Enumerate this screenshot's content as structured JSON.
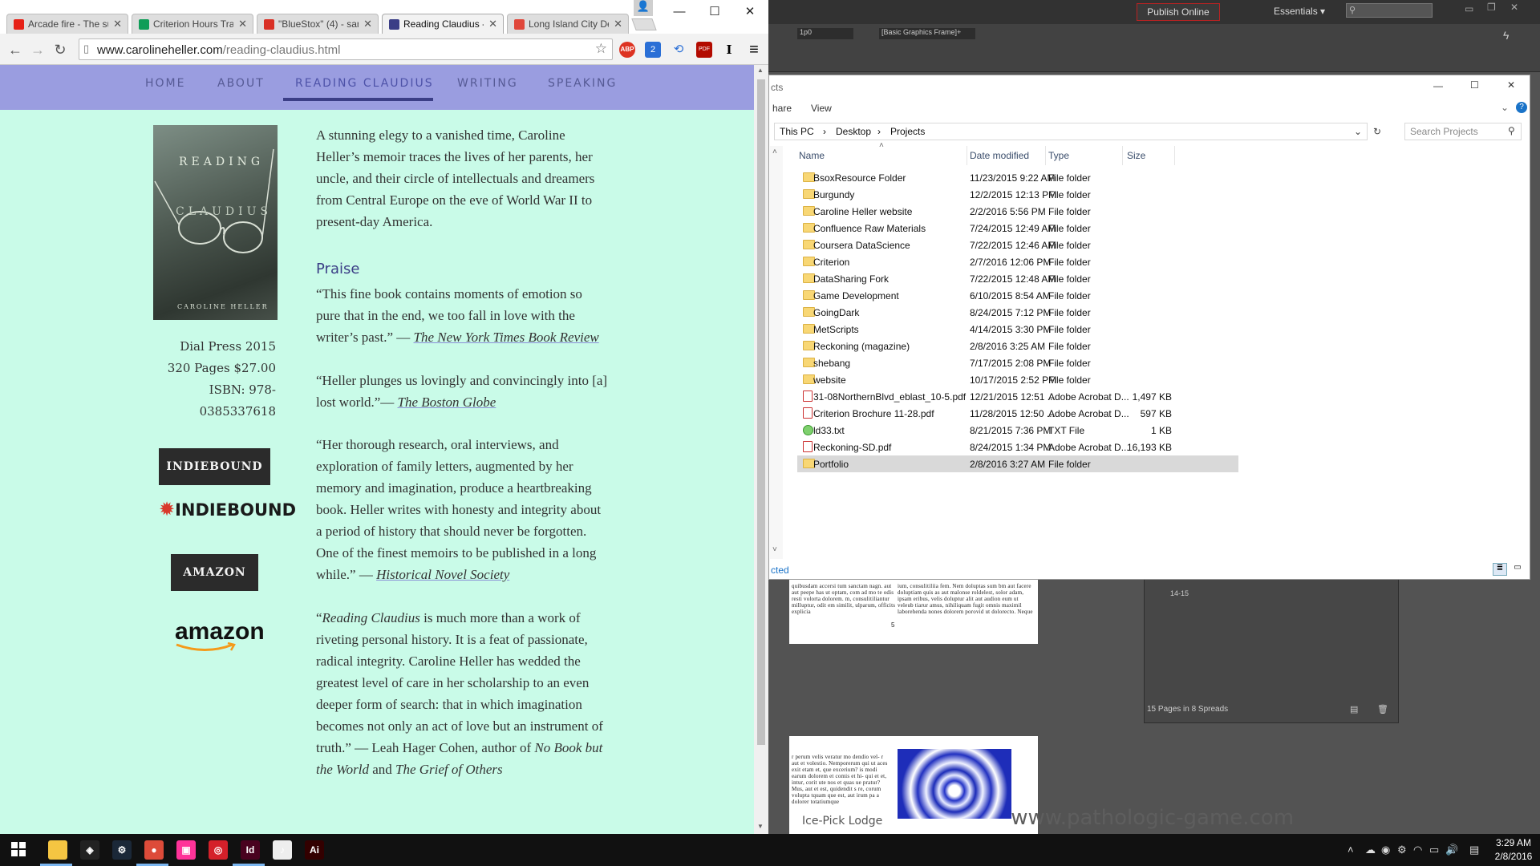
{
  "browser": {
    "tabs": [
      {
        "label": "Arcade fire - The su",
        "favicon_color": "#e62117"
      },
      {
        "label": "Criterion Hours Tra",
        "favicon_color": "#0f9d58"
      },
      {
        "label": "\"BlueStox\" (4) - san",
        "favicon_color": "#d93025"
      },
      {
        "label": "Reading Claudius - ",
        "favicon_color": "#3b3e86"
      },
      {
        "label": "Long Island City De",
        "favicon_color": "#e0473a"
      }
    ],
    "url_host": "www.carolineheller.com",
    "url_path": "/reading-claudius.html",
    "window_controls": {
      "minimize": "—",
      "maximize": "☐",
      "close": "✕"
    },
    "nav_icons": {
      "back": "←",
      "forward": "→",
      "reload": "↻",
      "star": "☆",
      "menu": "≡"
    },
    "extensions": [
      "ABP",
      "2",
      "⟲",
      "PDF",
      "I"
    ]
  },
  "site": {
    "nav": [
      "HOME",
      "ABOUT",
      "READING CLAUDIUS",
      "WRITING",
      "SPEAKING"
    ],
    "book": {
      "cover_title_1": "READING",
      "cover_title_2": "CLAUDIUS",
      "cover_author": "CAROLINE HELLER",
      "publisher": "Dial Press  2015",
      "pages_price": "320 Pages   $27.00",
      "isbn_1": "ISBN: 978-",
      "isbn_2": "0385337618"
    },
    "buy": {
      "indiebound": "INDIEBOUND",
      "indiebound_logo": "INDIEBOUND",
      "amazon": "AMAZON",
      "amazon_logo": "amazon"
    },
    "intro": "A stunning elegy to a vanished time, Caroline Heller’s memoir traces the lives of her parents, her uncle, and their circle of intellectuals and dreamers from Central Europe on the eve of World War II to present-day America.",
    "praise_heading": "Praise",
    "quotes": [
      {
        "text": " “This fine book contains moments of emotion so pure that in the end, we too fall in love with the writer’s past.” — ",
        "source": "The New York Times Book Review"
      },
      {
        "text": "“Heller plunges us lovingly and convincingly into [a] lost world.”— ",
        "source": "The Boston Globe"
      },
      {
        "text": "“Her thorough research, oral interviews, and exploration of family letters, augmented by her memory and imagination, produce a heartbreaking book. Heller writes with honesty and integrity about a period of history that should never be forgotten. One of the finest memoirs to be published in a long while.” — ",
        "source": "Historical Novel Society"
      }
    ],
    "quote4": {
      "open": "“",
      "title": "Reading Claudius",
      "body": " is much more than a work of riveting personal history. It is a feat of passionate, radical integrity. Caroline Heller has wedded the greatest level of care in her scholarship to an even deeper form of search: that in which imagination becomes not only an act of love but an instrument of truth.” — Leah Hager Cohen, author of ",
      "book1": "No Book but the World",
      "and": " and ",
      "book2": "The Grief of Others"
    }
  },
  "indesign": {
    "publish_label": "Publish Online",
    "workspace": "Essentials",
    "zoom_field": "1p0",
    "frame_style": "[Basic Graphics Frame]+",
    "pages_status": "15 Pages in 8 Spreads",
    "spread_label": "14-15",
    "page_number_mark": "5",
    "watermark": "www.pathologic-game.com",
    "watermark_left": "Ice-Pick Lodge",
    "doc_text_top": "quibusdam accersi tum sanctam nagn. aut aut peepe has ut optam, com ad mo te odis resti volorta dolorem. m, consulitiliantur milluptur, odit em similit, ulparum, officits explicia",
    "doc_text_top2": "ium, consulitiliia fem. Nem doluptas sum bm aut facere doluptiam quis as aut malonse roldelest, solor adam, ipsam eribus, velis doluptur alit aut audion eum ut veleub tiarur amus, nihiliquam fugit omnis maximil laborehenda nones dolorem porovid ut dolorecto. Neque",
    "doc_text_bottom": "r perum velis veratur mo dendio vel- r aut et volestio. Nemporerum qui ut aces exit etam et, que excerium? is modi earum dolorem et comis et hi- qui et et, intur, corit ute nos et quas ue pratur? Mus, aut et est, quidendit s re, corum volupta tquam que est, aut irum pa a dolorer totatiumque"
  },
  "explorer": {
    "title_fragment": "cts",
    "ribbon": [
      "hare",
      "View"
    ],
    "breadcrumb": [
      "This PC",
      "Desktop",
      "Projects"
    ],
    "search_placeholder": "Search Projects",
    "columns": [
      "Name",
      "Date modified",
      "Type",
      "Size"
    ],
    "status_fragment": "cted",
    "files": [
      {
        "name": "BsoxResource Folder",
        "date": "11/23/2015 9:22 AM",
        "type": "File folder",
        "size": "",
        "kind": "folder"
      },
      {
        "name": "Burgundy",
        "date": "12/2/2015 12:13 PM",
        "type": "File folder",
        "size": "",
        "kind": "folder"
      },
      {
        "name": "Caroline Heller website",
        "date": "2/2/2016 5:56 PM",
        "type": "File folder",
        "size": "",
        "kind": "folder"
      },
      {
        "name": "Confluence Raw Materials",
        "date": "7/24/2015 12:49 AM",
        "type": "File folder",
        "size": "",
        "kind": "folder"
      },
      {
        "name": "Coursera DataScience",
        "date": "7/22/2015 12:46 AM",
        "type": "File folder",
        "size": "",
        "kind": "folder"
      },
      {
        "name": "Criterion",
        "date": "2/7/2016 12:06 PM",
        "type": "File folder",
        "size": "",
        "kind": "folder"
      },
      {
        "name": "DataSharing Fork",
        "date": "7/22/2015 12:48 AM",
        "type": "File folder",
        "size": "",
        "kind": "folder"
      },
      {
        "name": "Game Development",
        "date": "6/10/2015 8:54 AM",
        "type": "File folder",
        "size": "",
        "kind": "folder"
      },
      {
        "name": "GoingDark",
        "date": "8/24/2015 7:12 PM",
        "type": "File folder",
        "size": "",
        "kind": "folder"
      },
      {
        "name": "MetScripts",
        "date": "4/14/2015 3:30 PM",
        "type": "File folder",
        "size": "",
        "kind": "folder"
      },
      {
        "name": "Reckoning (magazine)",
        "date": "2/8/2016 3:25 AM",
        "type": "File folder",
        "size": "",
        "kind": "folder"
      },
      {
        "name": "shebang",
        "date": "7/17/2015 2:08 PM",
        "type": "File folder",
        "size": "",
        "kind": "folder"
      },
      {
        "name": "website",
        "date": "10/17/2015 2:52 PM",
        "type": "File folder",
        "size": "",
        "kind": "folder"
      },
      {
        "name": "31-08NorthernBlvd_eblast_10-5.pdf",
        "date": "12/21/2015 12:51 ...",
        "type": "Adobe Acrobat D...",
        "size": "1,497 KB",
        "kind": "pdf"
      },
      {
        "name": "Criterion Brochure 11-28.pdf",
        "date": "11/28/2015 12:50 ...",
        "type": "Adobe Acrobat D...",
        "size": "597 KB",
        "kind": "pdf"
      },
      {
        "name": "ld33.txt",
        "date": "8/21/2015 7:36 PM",
        "type": "TXT File",
        "size": "1 KB",
        "kind": "txt"
      },
      {
        "name": "Reckoning-SD.pdf",
        "date": "8/24/2015 1:34 PM",
        "type": "Adobe Acrobat D...",
        "size": "16,193 KB",
        "kind": "pdf"
      },
      {
        "name": "Portfolio",
        "date": "2/8/2016 3:27 AM",
        "type": "File folder",
        "size": "",
        "kind": "folder"
      }
    ],
    "selected_index": 17
  },
  "taskbar": {
    "time": "3:29 AM",
    "date": "2/8/2016",
    "apps": [
      {
        "name": "file-explorer",
        "color": "#f5c542",
        "glyph": ""
      },
      {
        "name": "unity",
        "color": "#222222",
        "glyph": "◈"
      },
      {
        "name": "steam",
        "color": "#1b2838",
        "glyph": "⚙"
      },
      {
        "name": "chrome",
        "color": "#dd4b39",
        "glyph": "●"
      },
      {
        "name": "onenote",
        "color": "#ff3399",
        "glyph": "▣"
      },
      {
        "name": "creative-cloud",
        "color": "#d4202a",
        "glyph": "◎"
      },
      {
        "name": "indesign",
        "color": "#49021f",
        "glyph": "Id"
      },
      {
        "name": "itunes",
        "color": "#eeeeee",
        "glyph": "♪"
      },
      {
        "name": "illustrator",
        "color": "#330000",
        "glyph": "Ai"
      }
    ]
  }
}
